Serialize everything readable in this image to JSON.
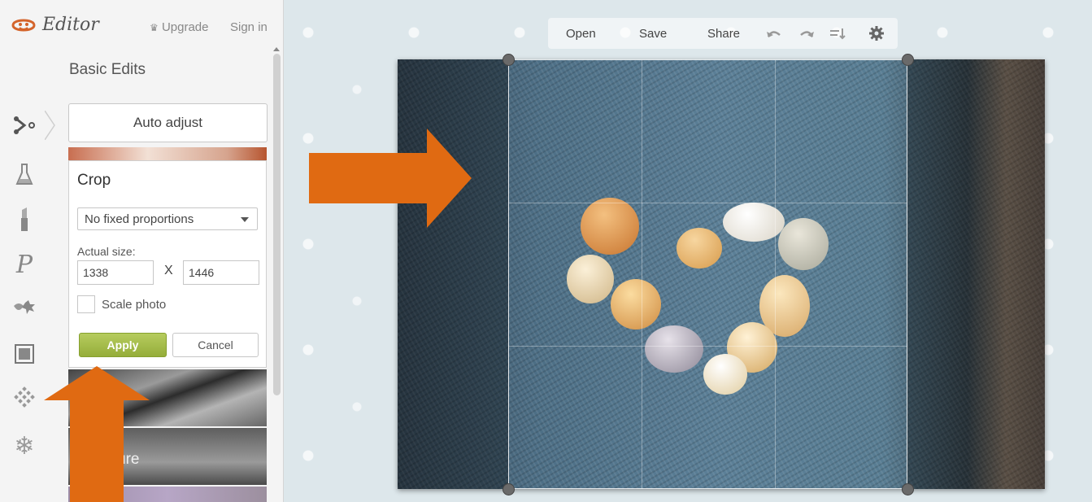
{
  "app": {
    "brand": "Editor",
    "upgrade": "Upgrade",
    "sign_in": "Sign in"
  },
  "panel": {
    "section_title": "Basic Edits",
    "auto_adjust": "Auto adjust",
    "crop": {
      "title": "Crop",
      "proportion": "No fixed proportions",
      "size_label": "Actual size:",
      "width": "1338",
      "height": "1446",
      "x": "X",
      "scale_label": "Scale photo",
      "apply": "Apply",
      "cancel": "Cancel"
    },
    "thumbs": [
      {
        "label": ""
      },
      {
        "label": "ure"
      },
      {
        "label": ""
      }
    ]
  },
  "rail_icons": [
    "basic-edits-icon",
    "effects-flask-icon",
    "touch-up-lipstick-icon",
    "text-p-icon",
    "overlays-icon",
    "frames-icon",
    "textures-icon",
    "seasonal-snowflake-icon"
  ],
  "toolbar": {
    "open": "Open",
    "save": "Save",
    "share": "Share",
    "icons": [
      "undo-icon",
      "redo-icon",
      "history-icon",
      "settings-gear-icon"
    ]
  },
  "colors": {
    "accent_arrow": "#e06a12",
    "apply_green": "#9db443"
  }
}
